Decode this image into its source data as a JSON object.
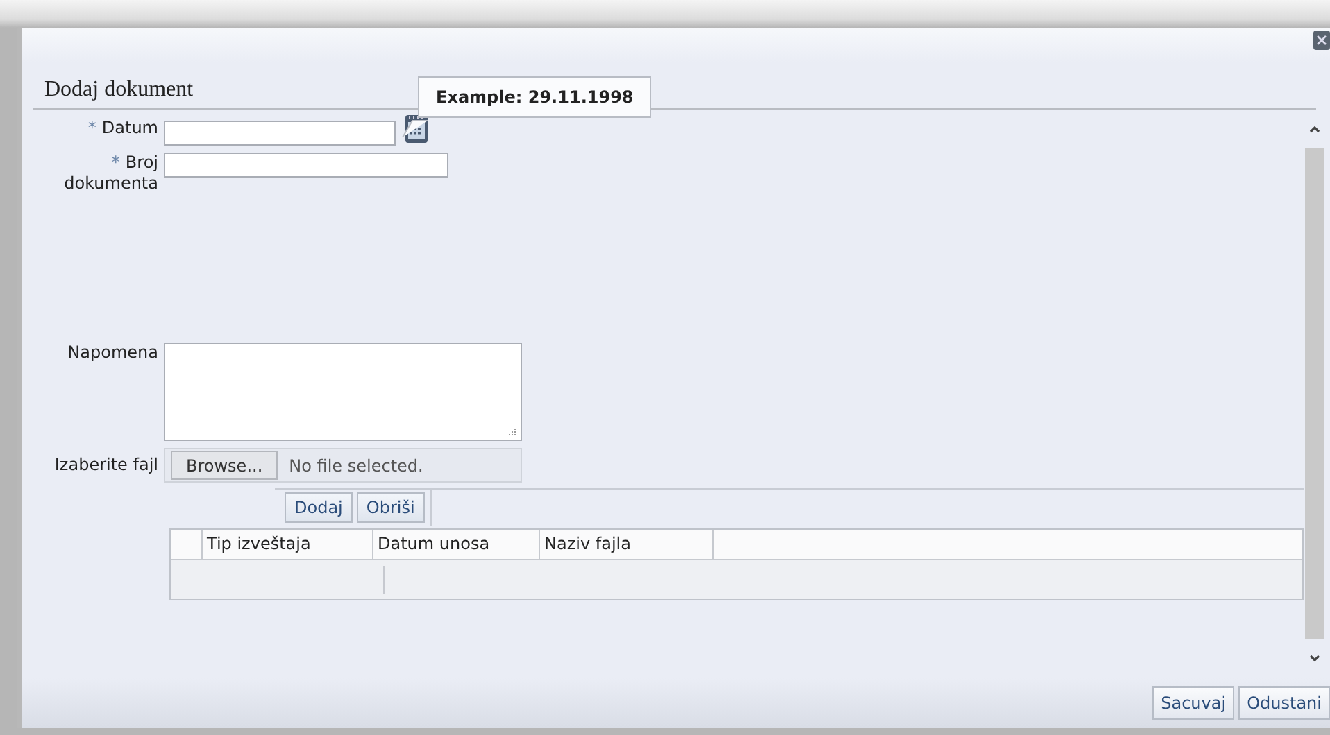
{
  "dialog": {
    "title": "Dodaj dokument"
  },
  "tooltip": {
    "text": "Example: 29.11.1998"
  },
  "fields": [
    {
      "kind": "date",
      "marker": "*",
      "label": "Datum"
    },
    {
      "kind": "text",
      "marker": "*",
      "label": "Broj dokumenta"
    },
    {
      "kind": "textarea",
      "label": "Napomena"
    },
    {
      "kind": "file",
      "label": "Izaberite fajl",
      "button": "Browse...",
      "status": "No file selected."
    }
  ],
  "toolbar": [
    "Dodaj",
    "Obriši"
  ],
  "table": {
    "columns": [
      "Tip izveštaja",
      "Datum unosa",
      "Naziv fajla"
    ]
  },
  "buttons": [
    "Sacuvaj",
    "Odustani"
  ]
}
